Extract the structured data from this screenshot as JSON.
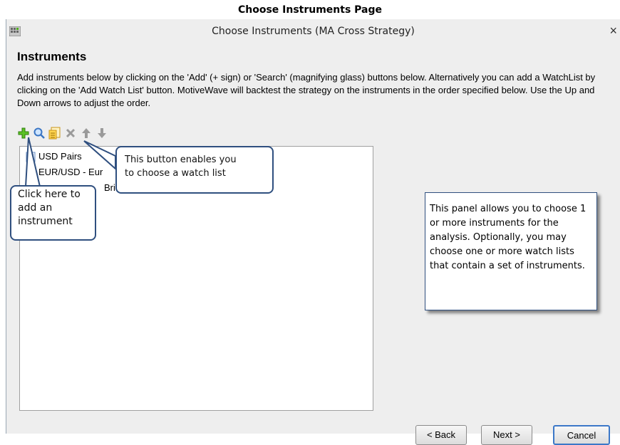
{
  "page_caption": "Choose Instruments Page",
  "window": {
    "title": "Choose Instruments (MA Cross Strategy)",
    "close_glyph": "×"
  },
  "heading": "Instruments",
  "description": "Add instruments below by clicking on the 'Add' (+ sign) or 'Search' (magnifying glass) buttons below. Alternatively you can add a WatchList by clicking on the 'Add Watch List' button. MotiveWave will backtest the strategy on the instruments in the order specified below. Use the Up and Down arrows to adjust the order.",
  "toolbar": {
    "buttons": [
      "add-icon",
      "search-icon",
      "watch-list-icon",
      "remove-icon",
      "arrow-up-icon",
      "arrow-down-icon"
    ]
  },
  "instruments": [
    {
      "label": "USD Pairs",
      "icon": "watch-list-icon"
    },
    {
      "label": "EUR/USD - Eur",
      "icon": "currency-icon"
    },
    {
      "label": "Briti",
      "icon": "currency-icon"
    }
  ],
  "buttons": {
    "back": "< Back",
    "next": "Next >",
    "cancel": "Cancel"
  },
  "callouts": {
    "watch_list": [
      "This button enables you",
      "to choose a watch list"
    ],
    "add_instrument": [
      "Click here to",
      "add an",
      "instrument"
    ],
    "panel_note": "This panel allows you to choose 1 or more instruments for the analysis.  Optionally, you may choose one or more watch lists that contain a set of instruments."
  },
  "colors": {
    "accent_green": "#4caf1a",
    "callout_border": "#2f4f7f",
    "window_bg": "#eeeeee"
  }
}
